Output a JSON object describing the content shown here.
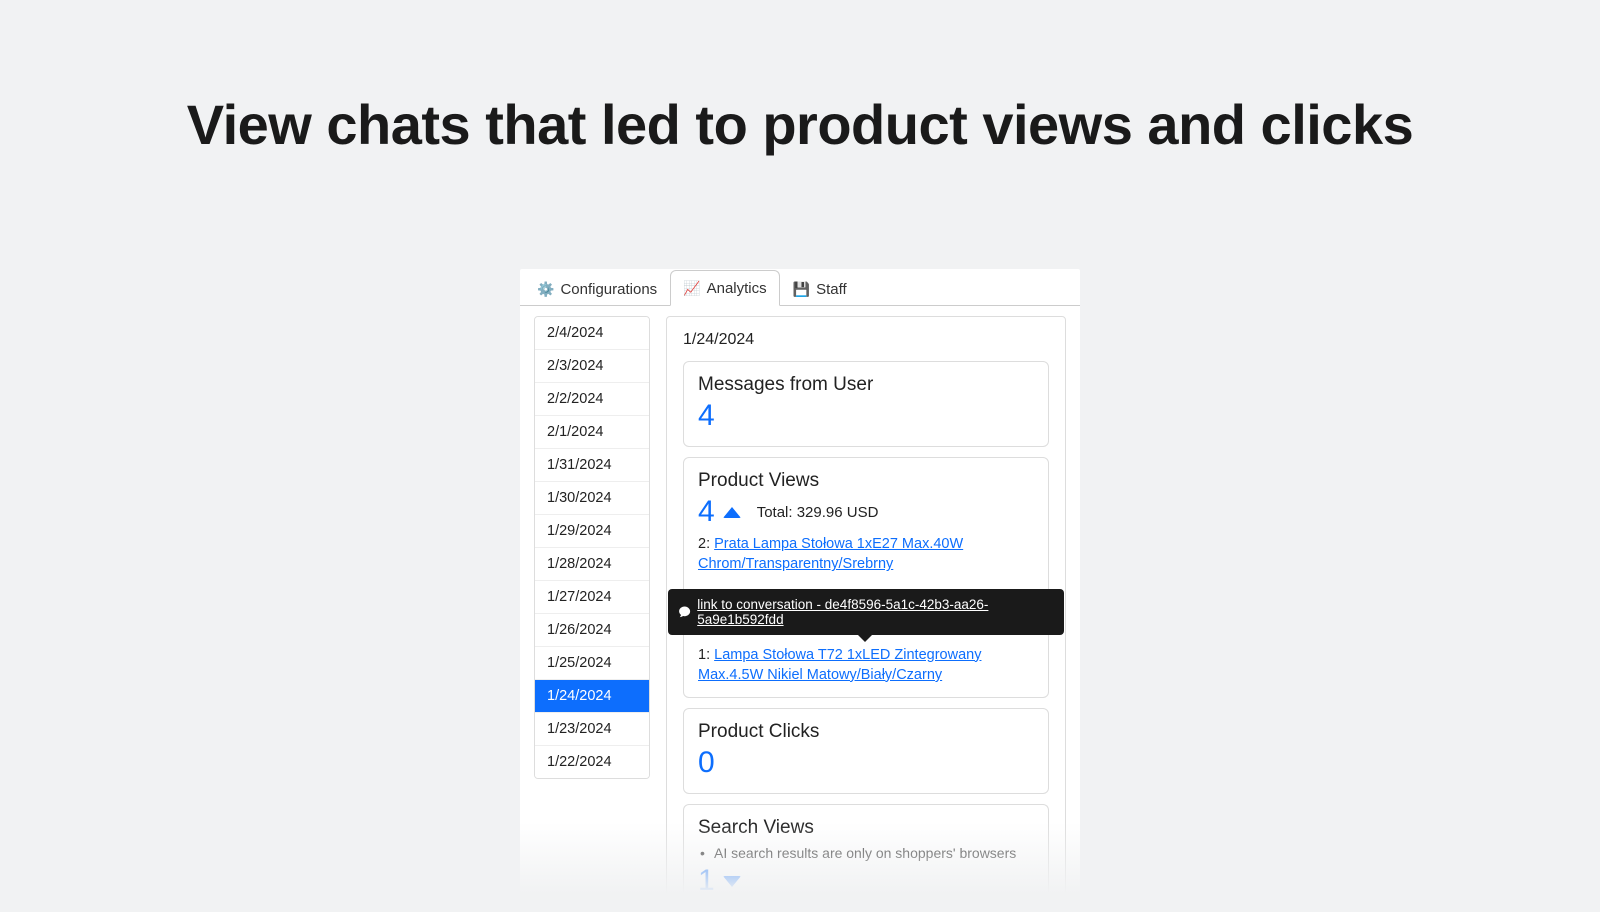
{
  "heading": "View chats that led to product views and clicks",
  "tabs": {
    "configurations": {
      "label": "Configurations",
      "icon": "⚙️"
    },
    "analytics": {
      "label": "Analytics",
      "icon": "📈"
    },
    "staff": {
      "label": "Staff",
      "icon": "💾"
    }
  },
  "dates": [
    "2/4/2024",
    "2/3/2024",
    "2/2/2024",
    "2/1/2024",
    "1/31/2024",
    "1/30/2024",
    "1/29/2024",
    "1/28/2024",
    "1/27/2024",
    "1/26/2024",
    "1/25/2024",
    "1/24/2024",
    "1/23/2024",
    "1/22/2024"
  ],
  "selected_date": "1/24/2024",
  "messages": {
    "title": "Messages from User",
    "value": "4"
  },
  "product_views": {
    "title": "Product Views",
    "value": "4",
    "total": "Total: 329.96 USD",
    "line1_count": "2: ",
    "line1_name": "Prata Lampa Stołowa 1xE27 Max.40W Chrom/Transparentny/Srebrny",
    "line2_count": "1: ",
    "line2_name": "Lampa Stołowa T72 1xLED Zintegrowany Max.4.5W Nikiel Matowy/Biały/Czarny"
  },
  "tooltip": {
    "text": "link to conversation - de4f8596-5a1c-42b3-aa26-5a9e1b592fdd"
  },
  "product_clicks": {
    "title": "Product Clicks",
    "value": "0"
  },
  "search_views": {
    "title": "Search Views",
    "note": "AI search results are only on shoppers' browsers",
    "value": "1"
  }
}
